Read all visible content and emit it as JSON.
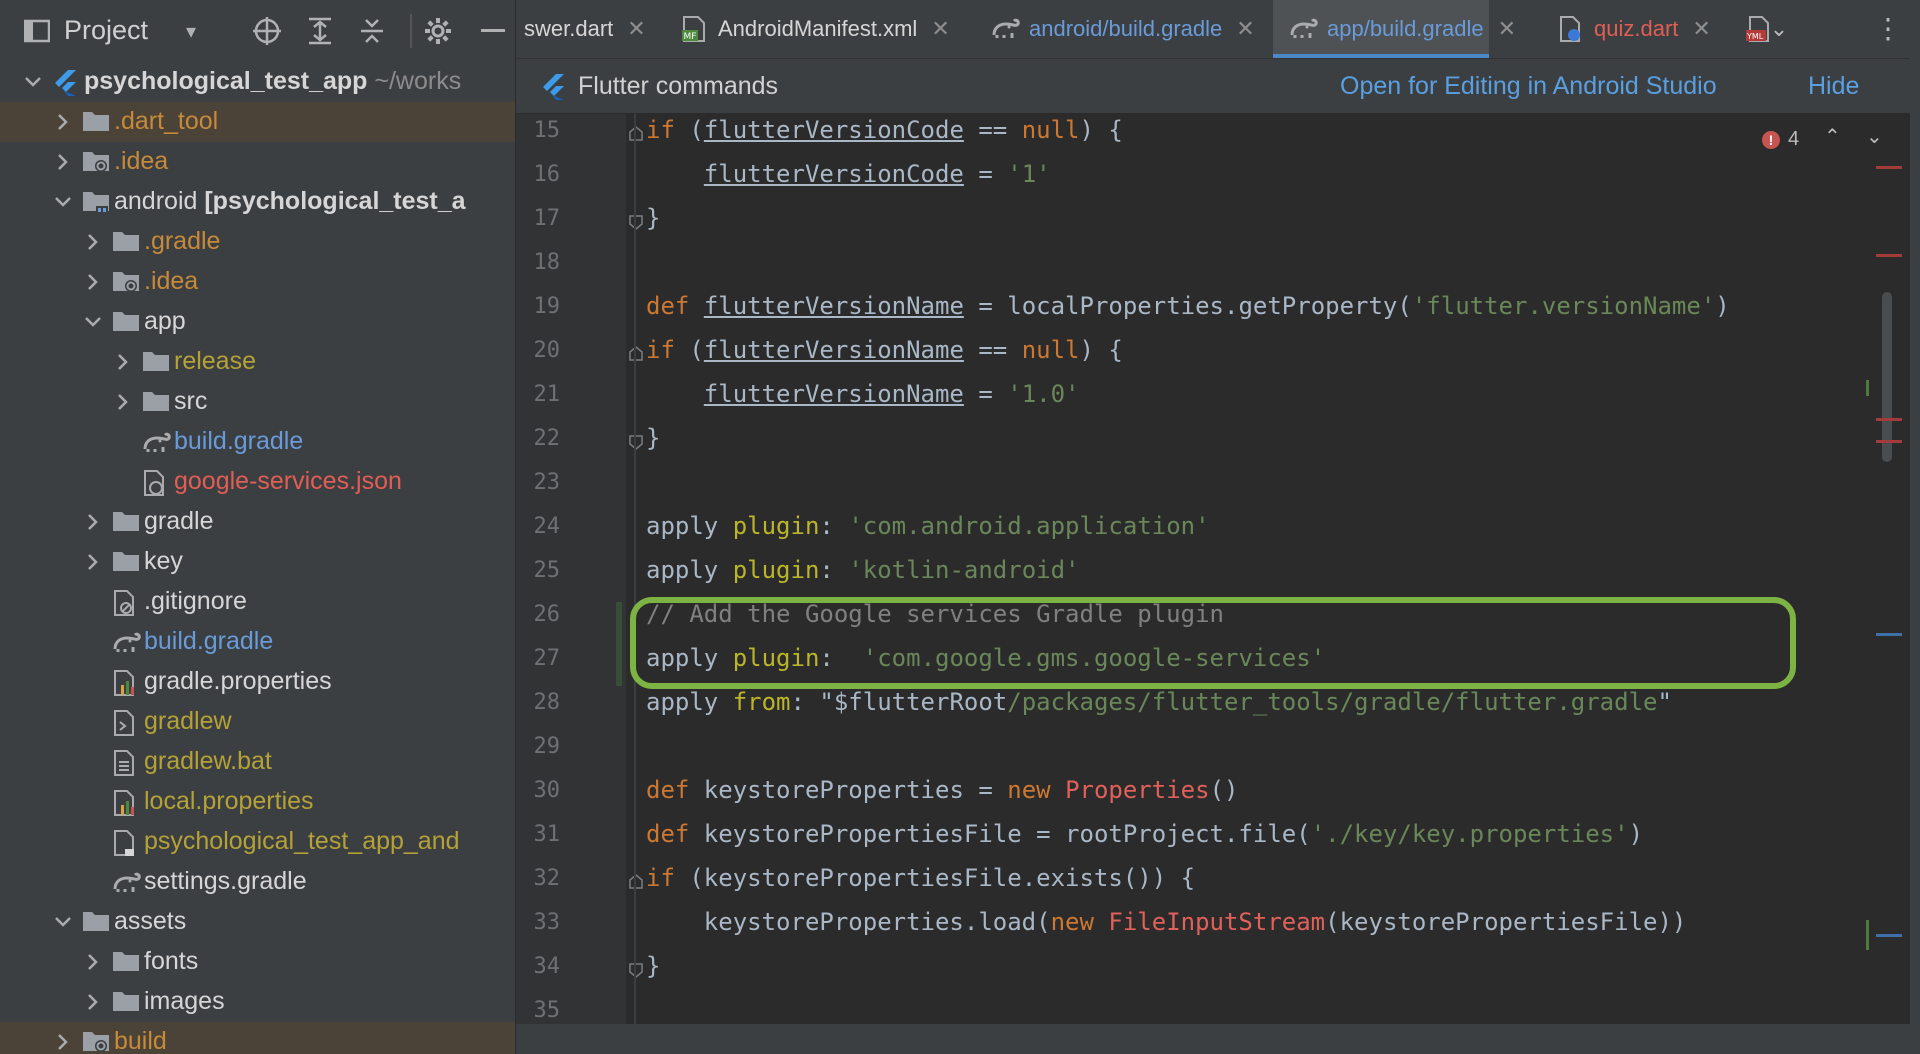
{
  "project_panel": {
    "title": "Project",
    "tree": [
      {
        "label": "psychological_test_app",
        "suffix": "~/works",
        "depth": 0,
        "expanded": true,
        "style": "bold",
        "icon": "flutter-icon"
      },
      {
        "label": ".dart_tool",
        "depth": 1,
        "expanded": false,
        "style": "ign",
        "icon": "folder-icon",
        "selected": true
      },
      {
        "label": ".idea",
        "depth": 1,
        "expanded": false,
        "style": "ign",
        "icon": "settings-folder-icon"
      },
      {
        "label": "android",
        "suffix": "[psychological_test_a",
        "depth": 1,
        "expanded": true,
        "style": "def",
        "icon": "module-folder-icon"
      },
      {
        "label": ".gradle",
        "depth": 2,
        "expanded": false,
        "style": "ign",
        "icon": "folder-icon"
      },
      {
        "label": ".idea",
        "depth": 2,
        "expanded": false,
        "style": "ign",
        "icon": "settings-folder-icon"
      },
      {
        "label": "app",
        "depth": 2,
        "expanded": true,
        "style": "def",
        "icon": "folder-icon"
      },
      {
        "label": "release",
        "depth": 3,
        "expanded": false,
        "style": "olive",
        "icon": "folder-icon"
      },
      {
        "label": "src",
        "depth": 3,
        "expanded": false,
        "style": "def",
        "icon": "folder-icon"
      },
      {
        "label": "build.gradle",
        "depth": 3,
        "leaf": true,
        "style": "mod",
        "icon": "gradle-icon"
      },
      {
        "label": "google-services.json",
        "depth": 3,
        "leaf": true,
        "style": "red",
        "icon": "json-file-icon"
      },
      {
        "label": "gradle",
        "depth": 2,
        "expanded": false,
        "style": "def",
        "icon": "folder-icon"
      },
      {
        "label": "key",
        "depth": 2,
        "expanded": false,
        "style": "def",
        "icon": "folder-icon"
      },
      {
        "label": ".gitignore",
        "depth": 2,
        "leaf": true,
        "style": "def",
        "icon": "gitignore-file-icon"
      },
      {
        "label": "build.gradle",
        "depth": 2,
        "leaf": true,
        "style": "mod",
        "icon": "gradle-icon"
      },
      {
        "label": "gradle.properties",
        "depth": 2,
        "leaf": true,
        "style": "def",
        "icon": "properties-file-icon"
      },
      {
        "label": "gradlew",
        "depth": 2,
        "leaf": true,
        "style": "olive",
        "icon": "shell-file-icon"
      },
      {
        "label": "gradlew.bat",
        "depth": 2,
        "leaf": true,
        "style": "olive",
        "icon": "text-file-icon"
      },
      {
        "label": "local.properties",
        "depth": 2,
        "leaf": true,
        "style": "olive",
        "icon": "properties-file-icon"
      },
      {
        "label": "psychological_test_app_and",
        "depth": 2,
        "leaf": true,
        "style": "olive",
        "icon": "iml-file-icon"
      },
      {
        "label": "settings.gradle",
        "depth": 2,
        "leaf": true,
        "style": "def",
        "icon": "gradle-icon"
      },
      {
        "label": "assets",
        "depth": 1,
        "expanded": true,
        "style": "def",
        "icon": "folder-icon"
      },
      {
        "label": "fonts",
        "depth": 2,
        "expanded": false,
        "style": "def",
        "icon": "folder-icon"
      },
      {
        "label": "images",
        "depth": 2,
        "expanded": false,
        "style": "def",
        "icon": "folder-icon"
      },
      {
        "label": "build",
        "depth": 1,
        "expanded": false,
        "style": "ign",
        "icon": "settings-folder-icon",
        "selected": true
      }
    ]
  },
  "tabs": [
    {
      "label": "swer.dart",
      "style": "def",
      "icon": ""
    },
    {
      "label": "AndroidManifest.xml",
      "style": "def",
      "icon": "manifest-icon"
    },
    {
      "label": "android/build.gradle",
      "style": "mod",
      "icon": "gradle-icon"
    },
    {
      "label": "app/build.gradle",
      "style": "mod",
      "icon": "gradle-icon",
      "active": true
    },
    {
      "label": "quiz.dart",
      "style": "red",
      "icon": "dart-file-icon"
    }
  ],
  "banner": {
    "label": "Flutter commands",
    "open_link": "Open for Editing in Android Studio",
    "hide_link": "Hide"
  },
  "editor": {
    "error_count": "4",
    "lines": [
      15,
      16,
      17,
      18,
      19,
      20,
      21,
      22,
      23,
      24,
      25,
      26,
      27,
      28,
      29,
      30,
      31,
      32,
      33,
      34,
      35
    ]
  },
  "colors": {
    "highlight_box": "#7cb342",
    "accent": "#4a88c7",
    "link": "#5a9fe0"
  }
}
